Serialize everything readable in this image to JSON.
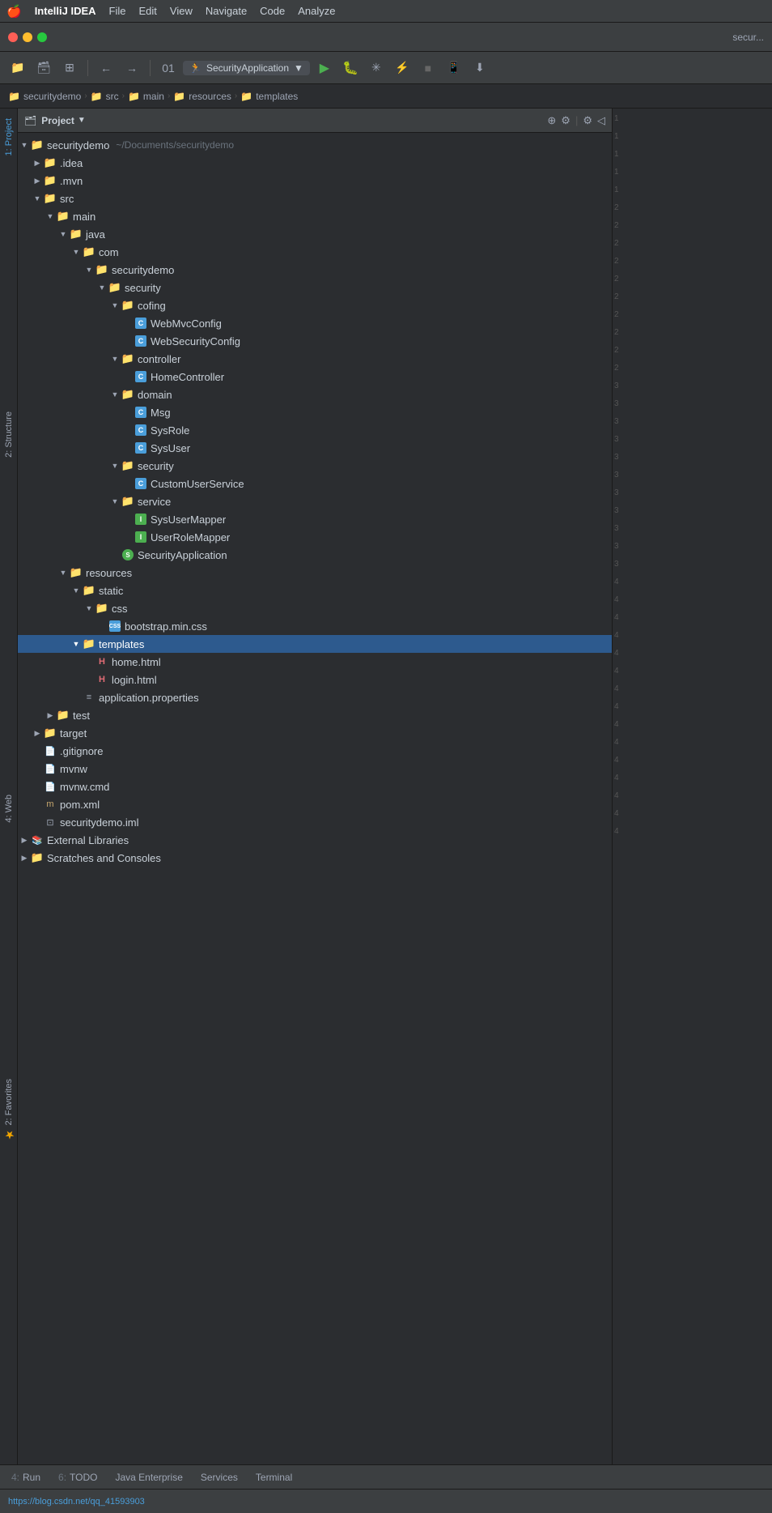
{
  "menubar": {
    "apple": "🍎",
    "app": "IntelliJ IDEA",
    "items": [
      "File",
      "Edit",
      "View",
      "Navigate",
      "Code",
      "Analyze"
    ]
  },
  "titlebar": {
    "title": "secur..."
  },
  "toolbar": {
    "run_config": "SecurityApplication",
    "buttons": [
      "open-folder",
      "sync",
      "switch-layout",
      "back",
      "forward",
      "build",
      "run",
      "debug",
      "coverage",
      "profile",
      "stop",
      "device",
      "download"
    ]
  },
  "breadcrumb": {
    "items": [
      {
        "label": "securitydemo",
        "type": "folder"
      },
      {
        "label": "src",
        "type": "folder"
      },
      {
        "label": "main",
        "type": "folder"
      },
      {
        "label": "resources",
        "type": "folder-res"
      },
      {
        "label": "templates",
        "type": "folder"
      }
    ]
  },
  "panel": {
    "title": "Project",
    "dropdown_label": "Project"
  },
  "tree": {
    "items": [
      {
        "id": "securitydemo-root",
        "indent": 0,
        "arrow": "open",
        "icon": "folder",
        "label": "securitydemo",
        "hint": "~/Documents/securitydemo",
        "level": 0
      },
      {
        "id": "idea",
        "indent": 1,
        "arrow": "closed",
        "icon": "folder",
        "label": ".idea",
        "level": 1
      },
      {
        "id": "mvn",
        "indent": 1,
        "arrow": "closed",
        "icon": "folder",
        "label": ".mvn",
        "level": 1
      },
      {
        "id": "src",
        "indent": 1,
        "arrow": "open",
        "icon": "folder-src",
        "label": "src",
        "level": 1
      },
      {
        "id": "main",
        "indent": 2,
        "arrow": "open",
        "icon": "folder",
        "label": "main",
        "level": 2
      },
      {
        "id": "java",
        "indent": 3,
        "arrow": "open",
        "icon": "folder-src",
        "label": "java",
        "level": 3
      },
      {
        "id": "com",
        "indent": 4,
        "arrow": "open",
        "icon": "folder",
        "label": "com",
        "level": 4
      },
      {
        "id": "securitydemo-pkg",
        "indent": 5,
        "arrow": "open",
        "icon": "folder",
        "label": "securitydemo",
        "level": 5
      },
      {
        "id": "security-pkg",
        "indent": 6,
        "arrow": "open",
        "icon": "folder",
        "label": "security",
        "level": 6
      },
      {
        "id": "cofing",
        "indent": 7,
        "arrow": "open",
        "icon": "folder",
        "label": "cofing",
        "level": 7
      },
      {
        "id": "webmvcconfig",
        "indent": 8,
        "arrow": "none",
        "icon": "class-c",
        "label": "WebMvcConfig",
        "level": 8
      },
      {
        "id": "websecurityconfig",
        "indent": 8,
        "arrow": "none",
        "icon": "class-c",
        "label": "WebSecurityConfig",
        "level": 8
      },
      {
        "id": "controller",
        "indent": 7,
        "arrow": "open",
        "icon": "folder",
        "label": "controller",
        "level": 7
      },
      {
        "id": "homecontroller",
        "indent": 8,
        "arrow": "none",
        "icon": "class-c",
        "label": "HomeController",
        "level": 8
      },
      {
        "id": "domain",
        "indent": 7,
        "arrow": "open",
        "icon": "folder",
        "label": "domain",
        "level": 7
      },
      {
        "id": "msg",
        "indent": 8,
        "arrow": "none",
        "icon": "class-c",
        "label": "Msg",
        "level": 8
      },
      {
        "id": "sysrole",
        "indent": 8,
        "arrow": "none",
        "icon": "class-c",
        "label": "SysRole",
        "level": 8
      },
      {
        "id": "sysuser",
        "indent": 8,
        "arrow": "none",
        "icon": "class-c",
        "label": "SysUser",
        "level": 8
      },
      {
        "id": "security2",
        "indent": 7,
        "arrow": "open",
        "icon": "folder",
        "label": "security",
        "level": 7
      },
      {
        "id": "customuserservice",
        "indent": 8,
        "arrow": "none",
        "icon": "class-c",
        "label": "CustomUserService",
        "level": 8
      },
      {
        "id": "service",
        "indent": 7,
        "arrow": "open",
        "icon": "folder",
        "label": "service",
        "level": 7
      },
      {
        "id": "sysusermapper",
        "indent": 8,
        "arrow": "none",
        "icon": "class-i",
        "label": "SysUserMapper",
        "level": 8
      },
      {
        "id": "userrolemapper",
        "indent": 8,
        "arrow": "none",
        "icon": "class-i",
        "label": "UserRoleMapper",
        "level": 8
      },
      {
        "id": "securityapp",
        "indent": 7,
        "arrow": "none",
        "icon": "class-spring",
        "label": "SecurityApplication",
        "level": 7
      },
      {
        "id": "resources",
        "indent": 3,
        "arrow": "open",
        "icon": "folder-res",
        "label": "resources",
        "level": 3
      },
      {
        "id": "static",
        "indent": 4,
        "arrow": "open",
        "icon": "folder",
        "label": "static",
        "level": 4
      },
      {
        "id": "css-dir",
        "indent": 5,
        "arrow": "open",
        "icon": "folder",
        "label": "css",
        "level": 5
      },
      {
        "id": "bootstrap",
        "indent": 6,
        "arrow": "none",
        "icon": "css-file",
        "label": "bootstrap.min.css",
        "level": 6
      },
      {
        "id": "templates",
        "indent": 4,
        "arrow": "open",
        "icon": "folder",
        "label": "templates",
        "level": 4,
        "selected": true
      },
      {
        "id": "home-html",
        "indent": 5,
        "arrow": "none",
        "icon": "html",
        "label": "home.html",
        "level": 5
      },
      {
        "id": "login-html",
        "indent": 5,
        "arrow": "none",
        "icon": "html",
        "label": "login.html",
        "level": 5
      },
      {
        "id": "app-props",
        "indent": 4,
        "arrow": "none",
        "icon": "properties",
        "label": "application.properties",
        "level": 4
      },
      {
        "id": "test",
        "indent": 2,
        "arrow": "closed",
        "icon": "folder",
        "label": "test",
        "level": 2
      },
      {
        "id": "target",
        "indent": 1,
        "arrow": "closed",
        "icon": "folder-orange",
        "label": "target",
        "level": 1
      },
      {
        "id": "gitignore",
        "indent": 1,
        "arrow": "none",
        "icon": "generic",
        "label": ".gitignore",
        "level": 1
      },
      {
        "id": "mvnw",
        "indent": 1,
        "arrow": "none",
        "icon": "generic",
        "label": "mvnw",
        "level": 1
      },
      {
        "id": "mvnw-cmd",
        "indent": 1,
        "arrow": "none",
        "icon": "generic",
        "label": "mvnw.cmd",
        "level": 1
      },
      {
        "id": "pom-xml",
        "indent": 1,
        "arrow": "none",
        "icon": "maven",
        "label": "pom.xml",
        "level": 1
      },
      {
        "id": "iml",
        "indent": 1,
        "arrow": "none",
        "icon": "iml",
        "label": "securitydemo.iml",
        "level": 1
      },
      {
        "id": "ext-libs",
        "indent": 0,
        "arrow": "closed",
        "icon": "external-lib",
        "label": "External Libraries",
        "level": 0
      },
      {
        "id": "scratches",
        "indent": 0,
        "arrow": "closed",
        "icon": "folder",
        "label": "Scratches and Consoles",
        "level": 0
      }
    ]
  },
  "line_numbers": [
    "1",
    "1",
    "1",
    "1",
    "1",
    "2",
    "2",
    "2",
    "2",
    "2",
    "2",
    "2",
    "2",
    "2",
    "2",
    "3",
    "3",
    "3",
    "3",
    "3",
    "3",
    "3",
    "3",
    "3",
    "3",
    "3",
    "4",
    "4",
    "4",
    "4",
    "4",
    "4",
    "4",
    "4",
    "4",
    "4",
    "4",
    "4",
    "4",
    "4",
    "4"
  ],
  "left_tabs": [
    {
      "label": "1: Project",
      "active": true
    },
    {
      "label": "2: Structure",
      "active": false
    },
    {
      "label": "4: Web",
      "active": false
    },
    {
      "label": "2: Favorites",
      "active": false
    }
  ],
  "right_tabs": [],
  "bottom_tabs": [
    {
      "num": "4",
      "label": "Run",
      "icon": "run"
    },
    {
      "num": "6",
      "label": "TODO",
      "icon": "todo"
    },
    {
      "num": "",
      "label": "Java Enterprise",
      "icon": "enterprise"
    },
    {
      "num": "",
      "label": "Services",
      "icon": "services"
    },
    {
      "num": "",
      "label": "Terminal",
      "icon": "terminal"
    }
  ],
  "statusbar": {
    "link": "https://blog.csdn.net/qq_41593903",
    "git_info": ""
  }
}
